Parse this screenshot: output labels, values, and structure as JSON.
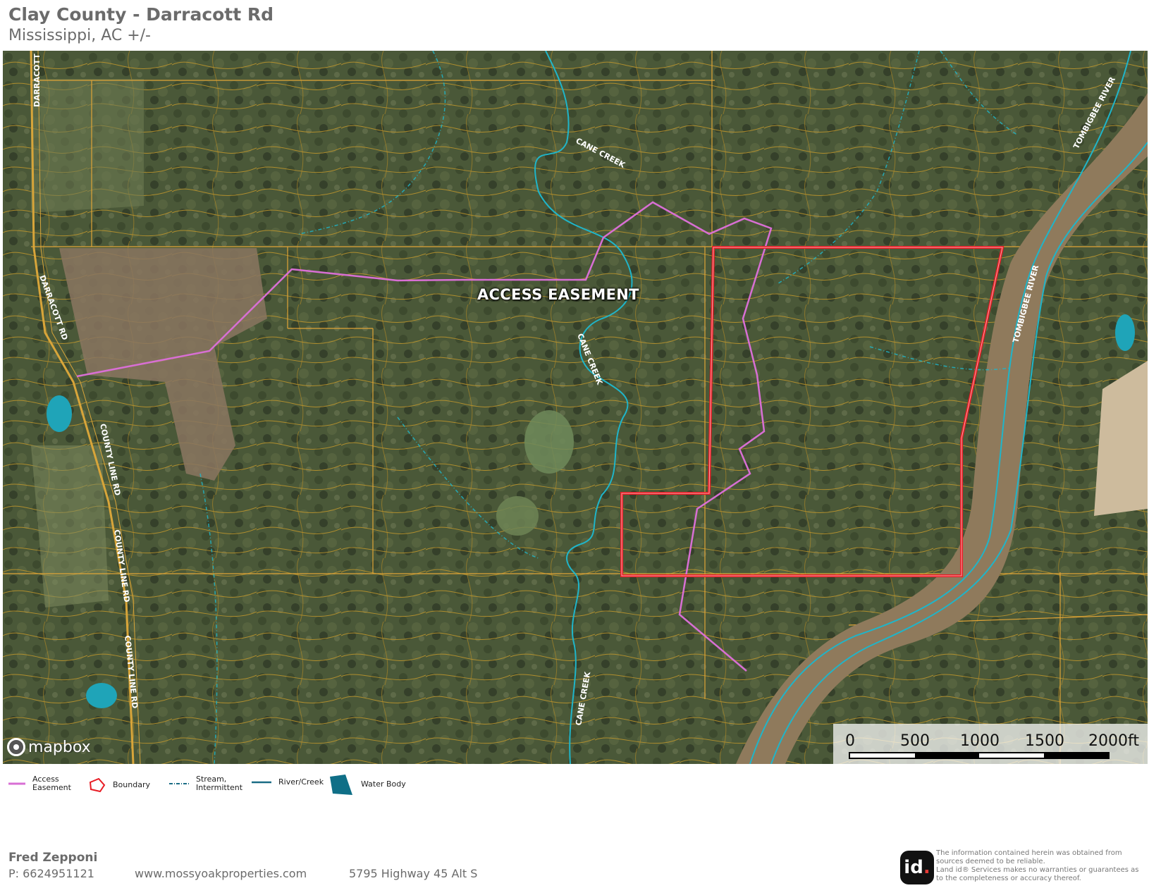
{
  "header": {
    "title": "Clay County - Darracott Rd",
    "subtitle": "Mississippi,  AC +/-"
  },
  "map": {
    "easement_label": "ACCESS EASEMENT",
    "road_labels": [
      "DARRACOTT RD",
      "DARRACOTT RD",
      "COUNTY LINE RD",
      "COUNTY LINE RD",
      "COUNTY LINE RD"
    ],
    "creek_labels": [
      "CANE CREEK",
      "CANE CREEK",
      "CANE CREEK"
    ],
    "river_labels": [
      "TOMBIGBEE RIVER",
      "TOMBIGBEE RIVER"
    ],
    "attribution": "mapbox",
    "scale": {
      "ticks": [
        "0",
        "500",
        "1000",
        "1500",
        "2000ft"
      ]
    },
    "colors": {
      "boundary": "#e81c24",
      "access_easement": "#d86fd4",
      "river": "#1fb5c9",
      "contour": "#c79a2a",
      "parcel_line": "#e0a437"
    }
  },
  "legend": [
    {
      "icon": "access-easement-line",
      "label": "Access\nEasement"
    },
    {
      "icon": "boundary-polygon",
      "label": "Boundary"
    },
    {
      "icon": "stream-intermittent-line",
      "label": "Stream,\nIntermittent"
    },
    {
      "icon": "river-creek-line",
      "label": "River/Creek"
    },
    {
      "icon": "water-body-polygon",
      "label": "Water Body"
    }
  ],
  "footer": {
    "agent_name": "Fred Zepponi",
    "phone": "P: 6624951121",
    "website": "www.mossyoakproperties.com",
    "address": "5795 Highway 45 Alt S",
    "logo_text": "id",
    "disclaimer": "The information contained herein was obtained from sources deemed to be reliable.\n Land id® Services makes no warranties or guarantees as to the completeness or accuracy thereof."
  }
}
